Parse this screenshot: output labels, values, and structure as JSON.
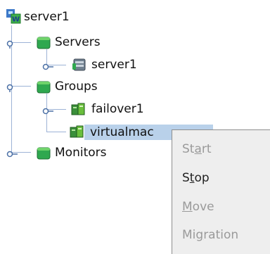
{
  "tree": {
    "root": {
      "label": "server1",
      "icon": "cluster-webmanager-icon"
    },
    "servers_group": {
      "label": "Servers",
      "icon": "green-folder-icon"
    },
    "server_node": {
      "label": "server1",
      "icon": "server-icon"
    },
    "groups_group": {
      "label": "Groups",
      "icon": "green-folder-icon"
    },
    "failover_node": {
      "label": "failover1",
      "icon": "failover-group-icon"
    },
    "vm_node": {
      "label": "virtualmac",
      "icon": "virtual-machine-group-icon",
      "selected": true
    },
    "monitors_group": {
      "label": "Monitors",
      "icon": "green-folder-icon"
    }
  },
  "context_menu": {
    "items": [
      {
        "pre": "St",
        "mnemonic": "a",
        "post": "rt",
        "enabled": false
      },
      {
        "pre": "S",
        "mnemonic": "t",
        "post": "op",
        "enabled": true
      },
      {
        "pre": "",
        "mnemonic": "M",
        "post": "ove",
        "enabled": false
      },
      {
        "pre": "Mi",
        "mnemonic": "g",
        "post": "ration",
        "enabled": false
      }
    ]
  },
  "colors": {
    "selection": "#b9d1ea",
    "connector": "#9db3d6",
    "menu_bg": "#eeeeee",
    "disabled_text": "#9a9a9a",
    "folder_green": "#2fa84f"
  }
}
